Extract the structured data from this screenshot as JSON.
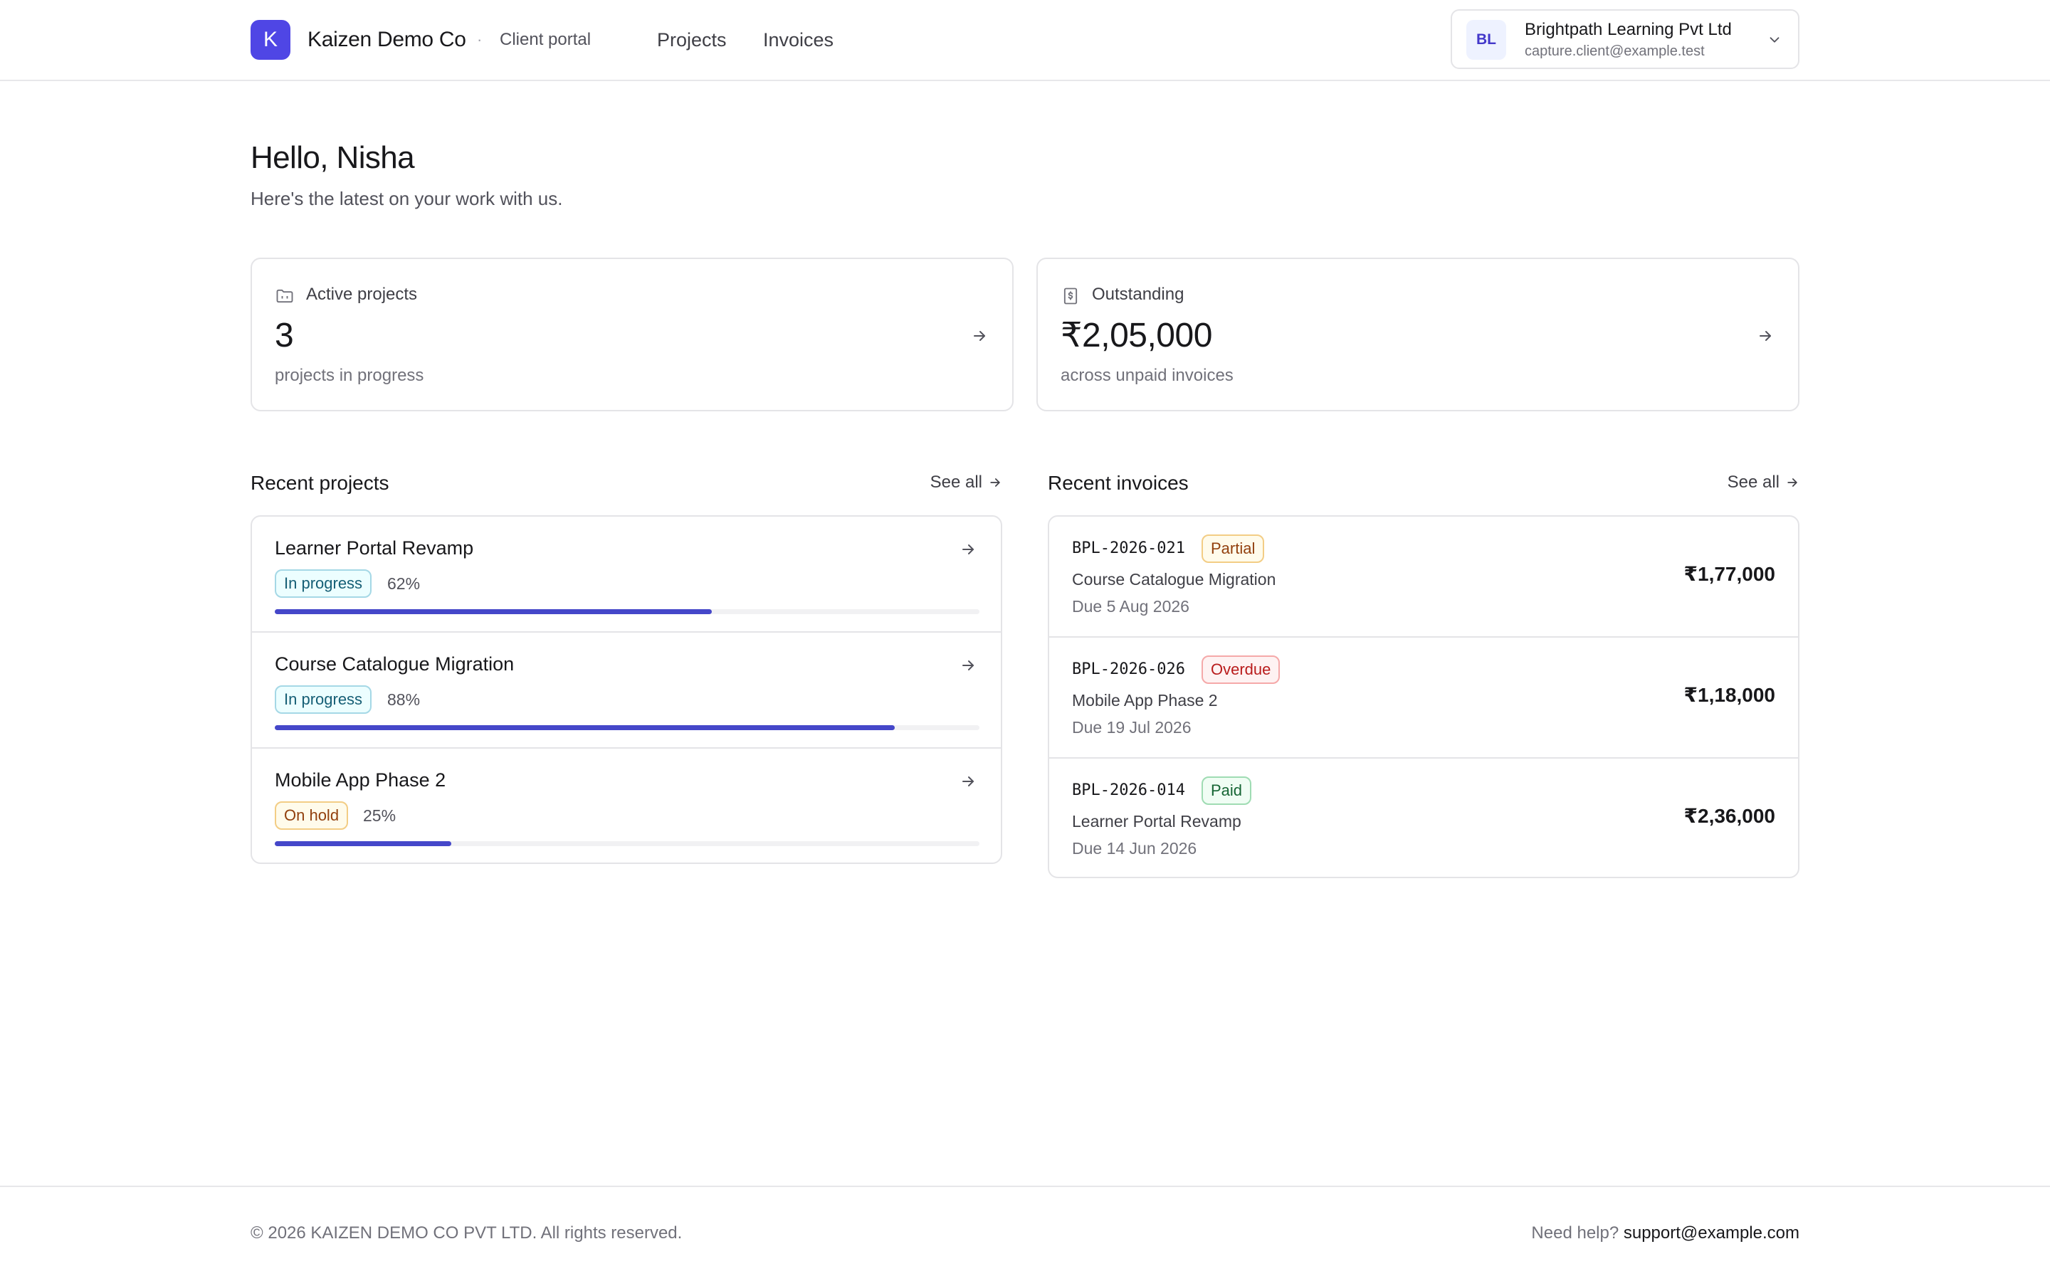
{
  "brand": {
    "logo_letter": "K",
    "name": "Kaizen Demo Co",
    "separator": "·",
    "subtitle": "Client portal",
    "accent_color": "#4f46e5"
  },
  "nav": {
    "projects": "Projects",
    "invoices": "Invoices"
  },
  "account": {
    "initials": "BL",
    "company": "Brightpath Learning Pvt Ltd",
    "email": "capture.client@example.test",
    "icon": "chevron-down-icon"
  },
  "greeting": {
    "title": "Hello, Nisha",
    "subtitle": "Here's the latest on your work with us."
  },
  "stats": {
    "active": {
      "icon": "folder-icon",
      "label": "Active projects",
      "value": "3",
      "caption": "projects in progress"
    },
    "outstanding": {
      "icon": "dollar-document-icon",
      "label": "Outstanding",
      "value": "₹2,05,000",
      "caption": "across unpaid invoices"
    }
  },
  "recent_projects": {
    "title": "Recent projects",
    "see_all": "See all",
    "items": [
      {
        "name": "Learner Portal Revamp",
        "status": "In progress",
        "status_type": "progress",
        "percent_label": "62%",
        "progress": 0.62
      },
      {
        "name": "Course Catalogue Migration",
        "status": "In progress",
        "status_type": "progress",
        "percent_label": "88%",
        "progress": 0.88
      },
      {
        "name": "Mobile App Phase 2",
        "status": "On hold",
        "status_type": "hold",
        "percent_label": "25%",
        "progress": 0.25
      }
    ]
  },
  "recent_invoices": {
    "title": "Recent invoices",
    "see_all": "See all",
    "items": [
      {
        "id": "BPL-2026-021",
        "status": "Partial",
        "status_type": "partial",
        "project": "Course Catalogue Migration",
        "due": "Due 5 Aug 2026",
        "amount": "₹1,77,000"
      },
      {
        "id": "BPL-2026-026",
        "status": "Overdue",
        "status_type": "overdue",
        "project": "Mobile App Phase 2",
        "due": "Due 19 Jul 2026",
        "amount": "₹1,18,000"
      },
      {
        "id": "BPL-2026-014",
        "status": "Paid",
        "status_type": "paid",
        "project": "Learner Portal Revamp",
        "due": "Due 14 Jun 2026",
        "amount": "₹2,36,000"
      }
    ]
  },
  "footer": {
    "copyright": "© 2026 KAIZEN DEMO CO PVT LTD. All rights reserved.",
    "help_prefix": "Need help?",
    "help_email": "support@example.com"
  }
}
